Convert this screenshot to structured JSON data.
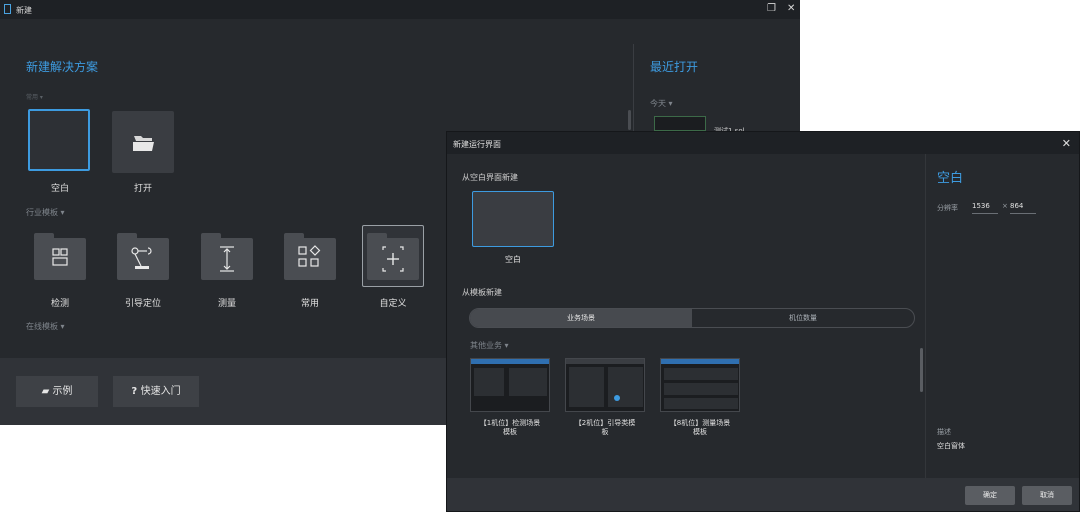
{
  "back_window": {
    "title": "新建",
    "titlebar_icons": [
      "restore-icon",
      "close-icon"
    ],
    "new_solution": {
      "heading": "新建解决方案",
      "recent_group_label": "常用 ▾",
      "items": [
        {
          "label": "空白",
          "icon": "blank"
        },
        {
          "label": "打开",
          "icon": "folder-open-icon"
        }
      ],
      "industry_label": "行业模板 ▾",
      "templates": [
        {
          "label": "检测",
          "icon": "inspect-icon"
        },
        {
          "label": "引导定位",
          "icon": "robot-arm-icon"
        },
        {
          "label": "测量",
          "icon": "measure-icon"
        },
        {
          "label": "常用",
          "icon": "grid-icon"
        },
        {
          "label": "自定义",
          "icon": "plus-frame-icon"
        }
      ],
      "online_label": "在线模板 ▾"
    },
    "recent": {
      "heading": "最近打开",
      "today_label": "今天 ▾",
      "partial_item": "测试1.sol"
    },
    "bottom_buttons": [
      {
        "label": "示例",
        "icon": "folder-icon"
      },
      {
        "label": "快速入门",
        "icon": "question-icon"
      }
    ]
  },
  "dialog": {
    "title": "新建运行界面",
    "from_blank_label": "从空白界面新建",
    "blank_tile_label": "空白",
    "from_template_label": "从模板新建",
    "segments": [
      "业务场景",
      "机位数量"
    ],
    "other_business_label": "其他业务 ▾",
    "templates": [
      {
        "line1": "【1机位】检测场景",
        "line2": "模板"
      },
      {
        "line1": "【2机位】引导类模",
        "line2": "板"
      },
      {
        "line1": "【8机位】测量场景",
        "line2": "模板"
      }
    ],
    "side": {
      "title": "空白",
      "resolution_label": "分辨率",
      "width": "1536",
      "sep": "×",
      "height": "864",
      "desc_label": "描述",
      "desc_value": "空白窗体"
    },
    "ok_label": "确定",
    "cancel_label": "取消"
  }
}
